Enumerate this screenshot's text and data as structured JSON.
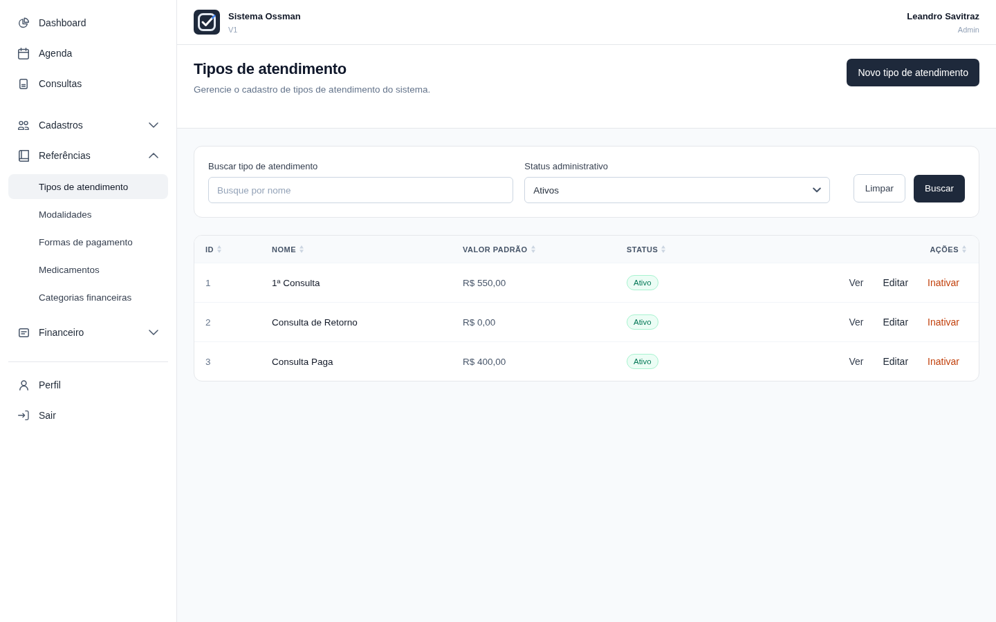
{
  "sidebar": {
    "sections": [
      {
        "divider": false,
        "items": [
          {
            "kind": "link",
            "label": "Dashboard",
            "selected": false
          },
          {
            "kind": "link",
            "label": "Agenda",
            "selected": false
          },
          {
            "kind": "link",
            "label": "Consultas",
            "selected": false
          }
        ]
      },
      {
        "divider": false,
        "items": [
          {
            "kind": "group",
            "label": "Cadastros",
            "expanded": false
          },
          {
            "kind": "group",
            "label": "Referências",
            "expanded": true,
            "children": [
              {
                "label": "Tipos de atendimento",
                "selected": true
              },
              {
                "label": "Modalidades",
                "selected": false
              },
              {
                "label": "Formas de pagamento",
                "selected": false
              },
              {
                "label": "Medicamentos",
                "selected": false
              },
              {
                "label": "Categorias financeiras",
                "selected": false
              }
            ]
          },
          {
            "kind": "group",
            "label": "Financeiro",
            "expanded": false
          }
        ]
      },
      {
        "divider": true,
        "items": [
          {
            "kind": "link",
            "label": "Perfil",
            "selected": false
          },
          {
            "kind": "link",
            "label": "Sair",
            "selected": false
          }
        ]
      }
    ]
  },
  "header": {
    "app_name": "Sistema Ossman",
    "version": "V1",
    "user_name": "Leandro Savitraz",
    "user_role": "Admin"
  },
  "page": {
    "title": "Tipos de atendimento",
    "subtitle": "Gerencie o cadastro de tipos de atendimento do sistema.",
    "primary_action": "Novo tipo de atendimento"
  },
  "filters": {
    "search": {
      "label": "Buscar tipo de atendimento",
      "placeholder": "Busque por nome"
    },
    "status": {
      "label": "Status administrativo",
      "value": "Ativos"
    },
    "buttons": [
      {
        "kind": "secondary",
        "label": "Limpar"
      },
      {
        "kind": "primary",
        "label": "Buscar"
      }
    ]
  },
  "table": {
    "columns": [
      {
        "label": "ID"
      },
      {
        "label": "NOME"
      },
      {
        "label": "VALOR PADRÃO"
      },
      {
        "label": "STATUS"
      },
      {
        "label": "AÇÕES"
      }
    ],
    "rows": [
      {
        "id": "1",
        "name": "1ª Consulta",
        "value": "R$ 550,00",
        "status": {
          "label": "Ativo",
          "active": true
        },
        "actions": [
          {
            "kind": "view",
            "label": "Ver"
          },
          {
            "kind": "edit",
            "label": "Editar"
          },
          {
            "kind": "deactivate",
            "label": "Inativar"
          }
        ]
      },
      {
        "id": "2",
        "name": "Consulta de Retorno",
        "value": "R$ 0,00",
        "status": {
          "label": "Ativo",
          "active": true
        },
        "actions": [
          {
            "kind": "view",
            "label": "Ver"
          },
          {
            "kind": "edit",
            "label": "Editar"
          },
          {
            "kind": "deactivate",
            "label": "Inativar"
          }
        ]
      },
      {
        "id": "3",
        "name": "Consulta Paga",
        "value": "R$ 400,00",
        "status": {
          "label": "Ativo",
          "active": true
        },
        "actions": [
          {
            "kind": "view",
            "label": "Ver"
          },
          {
            "kind": "edit",
            "label": "Editar"
          },
          {
            "kind": "deactivate",
            "label": "Inativar"
          }
        ]
      }
    ]
  }
}
